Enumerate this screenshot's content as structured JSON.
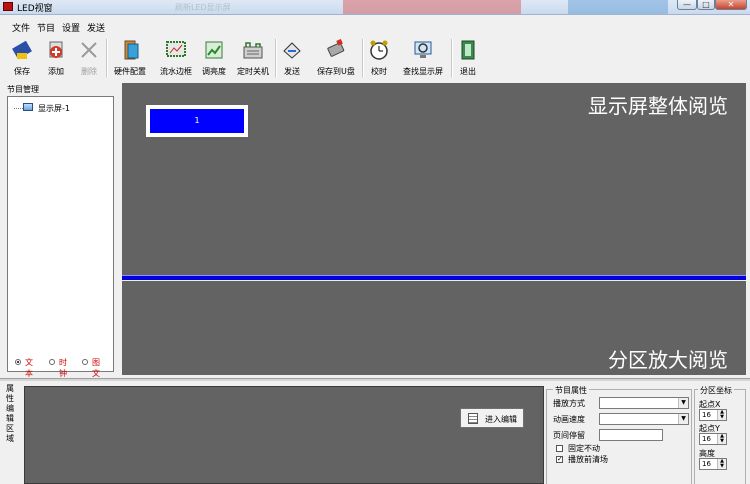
{
  "window": {
    "title": "LED视窗",
    "blurred_tab": "刷新LED显示屏",
    "min_label": "—",
    "max_label": "□",
    "close_label": "✕"
  },
  "menu": [
    "文件",
    "节目",
    "设置",
    "发送"
  ],
  "toolbar": [
    {
      "label": "保存",
      "icon": "save-icon",
      "enabled": true
    },
    {
      "label": "添加",
      "icon": "add-icon",
      "enabled": true
    },
    {
      "label": "删除",
      "icon": "delete-icon",
      "enabled": false
    },
    {
      "label": "硬件配置",
      "icon": "hardware-config-icon",
      "enabled": true
    },
    {
      "label": "流水边框",
      "icon": "border-icon",
      "enabled": true
    },
    {
      "label": "调亮度",
      "icon": "brightness-icon",
      "enabled": true
    },
    {
      "label": "定时关机",
      "icon": "timer-shutdown-icon",
      "enabled": true
    },
    {
      "label": "发送",
      "icon": "send-icon",
      "enabled": true
    },
    {
      "label": "保存到U盘",
      "icon": "usb-icon",
      "enabled": true
    },
    {
      "label": "校时",
      "icon": "clock-icon",
      "enabled": true
    },
    {
      "label": "查找显示屏",
      "icon": "find-screen-icon",
      "enabled": true
    },
    {
      "label": "退出",
      "icon": "exit-icon",
      "enabled": true
    }
  ],
  "program_manager": {
    "title": "节目管理",
    "tree": [
      {
        "label": "显示屏-1"
      }
    ],
    "radios": [
      {
        "label": "文本",
        "checked": true
      },
      {
        "label": "时钟",
        "checked": false
      },
      {
        "label": "图文",
        "checked": false
      }
    ]
  },
  "preview": {
    "overall_caption": "显示屏整体阅览",
    "zoom_caption": "分区放大阅览",
    "screen_label": "1",
    "screen_color": "#0000ff",
    "divider_color": "#0000e0"
  },
  "bottom": {
    "vertical_label": "属性编辑区域",
    "enter_edit_label": "进入编辑",
    "program_props": {
      "title": "节目属性",
      "play_mode_label": "播放方式",
      "anim_speed_label": "动画速度",
      "page_stay_label": "页间停留",
      "fixed_label": "固定不动",
      "fixed_checked": false,
      "clear_label": "播放前清场",
      "clear_checked": true
    },
    "coords": {
      "title": "分区坐标",
      "x_label": "起点X",
      "x_value": "16",
      "y_label": "起点Y",
      "y_value": "16",
      "h_label": "高度",
      "h_value": "16"
    }
  }
}
